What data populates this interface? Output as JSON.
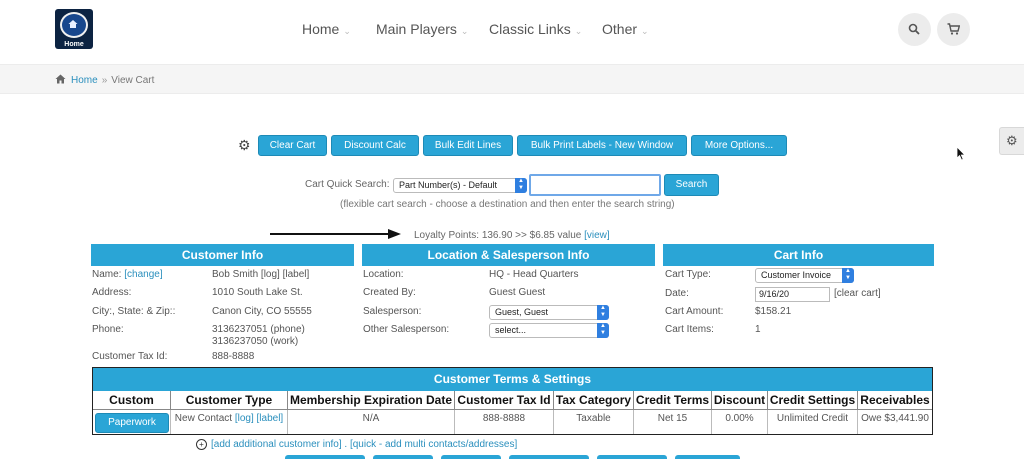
{
  "header": {
    "logo_text": "Home",
    "nav": [
      {
        "label": "Home"
      },
      {
        "label": "Main Players"
      },
      {
        "label": "Classic Links"
      },
      {
        "label": "Other"
      }
    ],
    "chevron": "⌄",
    "icons": {
      "search": "search-icon",
      "cart": "cart-icon"
    }
  },
  "breadcrumb": {
    "home": "Home",
    "separator": "»",
    "current": "View Cart"
  },
  "toolbar": {
    "buttons": [
      "Clear Cart",
      "Discount Calc",
      "Bulk Edit Lines",
      "Bulk Print Labels - New Window",
      "More Options..."
    ]
  },
  "search": {
    "label": "Cart Quick Search:",
    "destination": "Part Number(s) - Default",
    "value": "",
    "button": "Search",
    "hint": "(flexible cart search - choose a destination and then enter the search string)"
  },
  "loyalty": {
    "text": "Loyalty Points: 136.90 >> $6.85 value",
    "link": "[view]"
  },
  "customer_info": {
    "title": "Customer Info",
    "name_label": "Name:",
    "name_change": "[change]",
    "name_value": "Bob Smith [log] [label]",
    "address_label": "Address:",
    "address_value": "1010 South Lake St.",
    "city_label": "City:, State: & Zip::",
    "city_value": "Canon City, CO 55555",
    "phone_label": "Phone:",
    "phone_1": "3136237051 (phone)",
    "phone_2": "3136237050 (work)",
    "tax_label": "Customer Tax Id:",
    "tax_value": "888-8888"
  },
  "location_info": {
    "title": "Location & Salesperson Info",
    "location_label": "Location:",
    "location_value": "HQ - Head Quarters",
    "created_label": "Created By:",
    "created_value": "Guest Guest",
    "salesperson_label": "Salesperson:",
    "salesperson_value": "Guest, Guest",
    "other_label": "Other Salesperson:",
    "other_value": "select..."
  },
  "cart_info": {
    "title": "Cart Info",
    "type_label": "Cart Type:",
    "type_value": "Customer Invoice",
    "date_label": "Date:",
    "date_value": "9/16/20",
    "clear_link": "[clear cart]",
    "amount_label": "Cart Amount:",
    "amount_value": "$158.21",
    "items_label": "Cart Items:",
    "items_value": "1"
  },
  "terms": {
    "title": "Customer Terms & Settings",
    "columns": [
      "Custom",
      "Customer Type",
      "Membership Expiration Date",
      "Customer Tax Id",
      "Tax Category",
      "Credit Terms",
      "Discount",
      "Credit Settings",
      "Receivables"
    ],
    "row": {
      "custom": "Paperwork",
      "customer_type": "New Contact",
      "customer_type_links": "[log] [label]",
      "membership": "N/A",
      "tax_id": "888-8888",
      "tax_category": "Taxable",
      "credit_terms": "Net 15",
      "discount": "0.00%",
      "credit_settings": "Unlimited Credit",
      "receivables": "Owe $3,441.90"
    }
  },
  "footer_links": {
    "plus": "+",
    "text": "[add additional customer info] . [quick - add multi contacts/addresses]"
  },
  "colors": {
    "accent": "#2aa5d6",
    "link": "#2a8fbd"
  }
}
